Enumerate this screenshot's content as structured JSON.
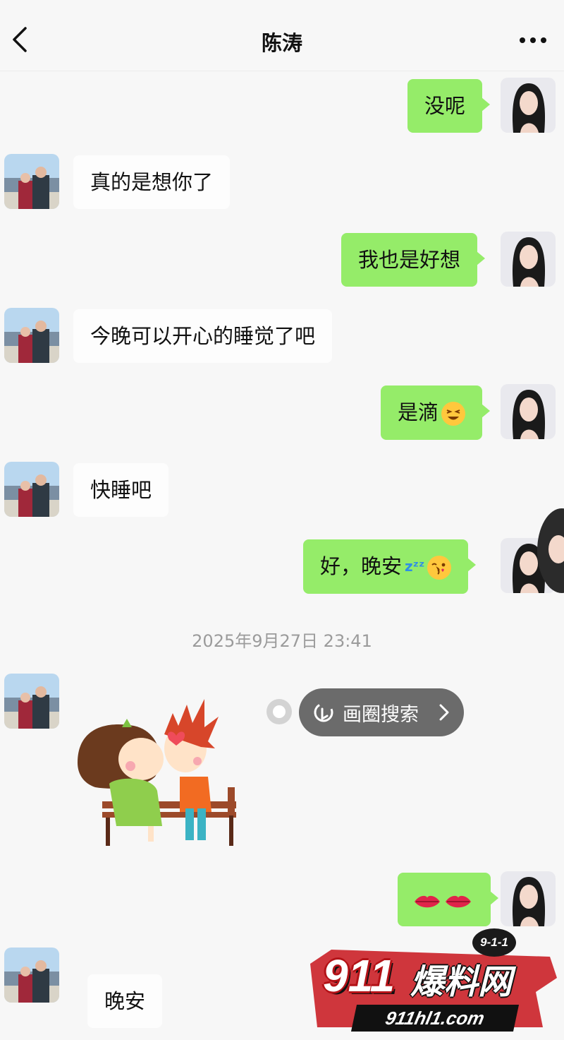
{
  "header": {
    "title": "陈涛",
    "back_icon": "chevron-left-icon",
    "more_icon": "more-dots-icon"
  },
  "messages": [
    {
      "side": "out",
      "text": "没呢"
    },
    {
      "side": "in",
      "text": "真的是想你了"
    },
    {
      "side": "out",
      "text": "我也是好想"
    },
    {
      "side": "in",
      "text": "今晚可以开心的睡觉了吧"
    },
    {
      "side": "out",
      "text": "是滴",
      "emoji": "grinning-squint-emoji"
    },
    {
      "side": "in",
      "text": "快睡吧"
    },
    {
      "side": "out",
      "text": "好，晚安",
      "emoji": "zzz-and-kissing-face-emoji"
    },
    {
      "side": "in",
      "sticker": "kissing-couple-on-bench-sticker"
    },
    {
      "side": "out",
      "emoji": "lips-emoji"
    },
    {
      "side": "in",
      "text": "晚安"
    }
  ],
  "timestamp": "2025年9月27日 23:41",
  "circle_search": {
    "label": "画圈搜索",
    "icon": "circle-gesture-icon"
  },
  "watermark": {
    "badge": "9-1-1",
    "number": "911",
    "name": "爆料网",
    "url": "911hl1.com"
  },
  "colors": {
    "background": "#f7f7f7",
    "outgoing_bubble": "#95ec69",
    "incoming_bubble": "#fdfdfd",
    "pill": "#6b6b6b"
  }
}
